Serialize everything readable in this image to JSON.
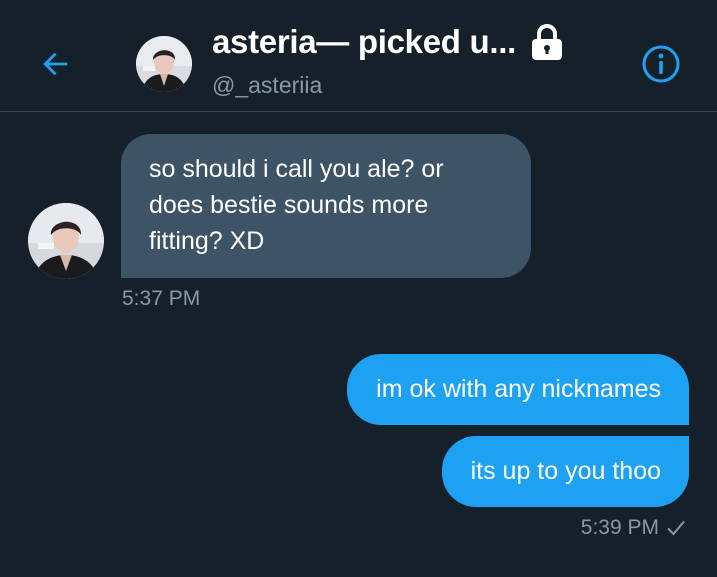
{
  "header": {
    "title": "asteria— picked u...",
    "handle": "@_asteriia",
    "back_icon": "arrow-left-icon",
    "lock_icon": "lock-icon",
    "info_icon": "info-icon"
  },
  "messages": [
    {
      "direction": "incoming",
      "text": "so should i call you ale? or does bestie sounds more fitting? XD",
      "time": "5:37 PM"
    },
    {
      "direction": "outgoing",
      "text": "im ok with any nicknames"
    },
    {
      "direction": "outgoing",
      "text": "its up to you thoo",
      "time": "5:39 PM",
      "status_icon": "checkmark-icon"
    }
  ],
  "colors": {
    "background": "#15202b",
    "accent": "#1da1f2",
    "incoming_bubble": "#3d5466",
    "muted_text": "#8899a6",
    "divider": "#38444d"
  }
}
